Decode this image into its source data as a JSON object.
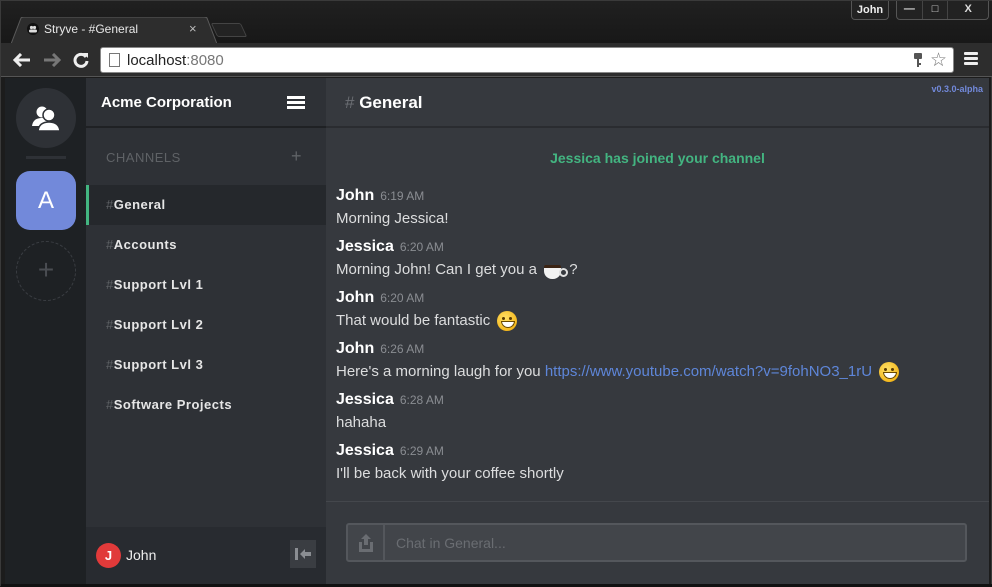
{
  "browser": {
    "tab_title": "Stryve - #General",
    "tab_close": "×",
    "profile_name": "John",
    "window_controls": {
      "minimize": "—",
      "maximize": "□",
      "close": "X"
    },
    "nav": {
      "back": "🡐",
      "forward": "🡒",
      "reload": "C"
    },
    "url_host": "localhost",
    "url_port": ":8080"
  },
  "servers": {
    "active_server_initial": "A",
    "add_server": "+"
  },
  "sidebar": {
    "guild_name": "Acme Corporation",
    "channels_header": "CHANNELS",
    "add_channel": "+",
    "channels": [
      {
        "hash": "#",
        "name": "General",
        "active": true
      },
      {
        "hash": "#",
        "name": "Accounts",
        "active": false
      },
      {
        "hash": "#",
        "name": "Support Lvl 1",
        "active": false
      },
      {
        "hash": "#",
        "name": "Support Lvl 2",
        "active": false
      },
      {
        "hash": "#",
        "name": "Support Lvl 3",
        "active": false
      },
      {
        "hash": "#",
        "name": "Software Projects",
        "active": false
      }
    ],
    "user": {
      "initial": "J",
      "name": "John",
      "avatar_color": "#e13a3a"
    }
  },
  "main": {
    "channel_hash": "#",
    "channel_name": "General",
    "version": "v0.3.0-alpha",
    "join_notice": "Jessica has joined your channel",
    "messages": [
      {
        "author": "John",
        "time": "6:19 AM",
        "text": "Morning Jessica!"
      },
      {
        "author": "Jessica",
        "time": "6:20 AM",
        "text": "Morning John! Can I get you a",
        "emoji": "coffee-emoji",
        "suffix": " ?"
      },
      {
        "author": "John",
        "time": "6:20 AM",
        "text": "That would be fantastic",
        "emoji": "grinning-emoji"
      },
      {
        "author": "John",
        "time": "6:26 AM",
        "text": "Here's a morning laugh for you",
        "link": "https://www.youtube.com/watch?v=9fohNO3_1rU",
        "emoji": "grinning-emoji"
      },
      {
        "author": "Jessica",
        "time": "6:28 AM",
        "text": "hahaha"
      },
      {
        "author": "Jessica",
        "time": "6:29 AM",
        "text": "I'll be back with your coffee shortly"
      }
    ],
    "input_placeholder": "Chat in General..."
  },
  "colors": {
    "accent": "#7289da",
    "online_green": "#43b581",
    "link": "#5e86d9"
  }
}
